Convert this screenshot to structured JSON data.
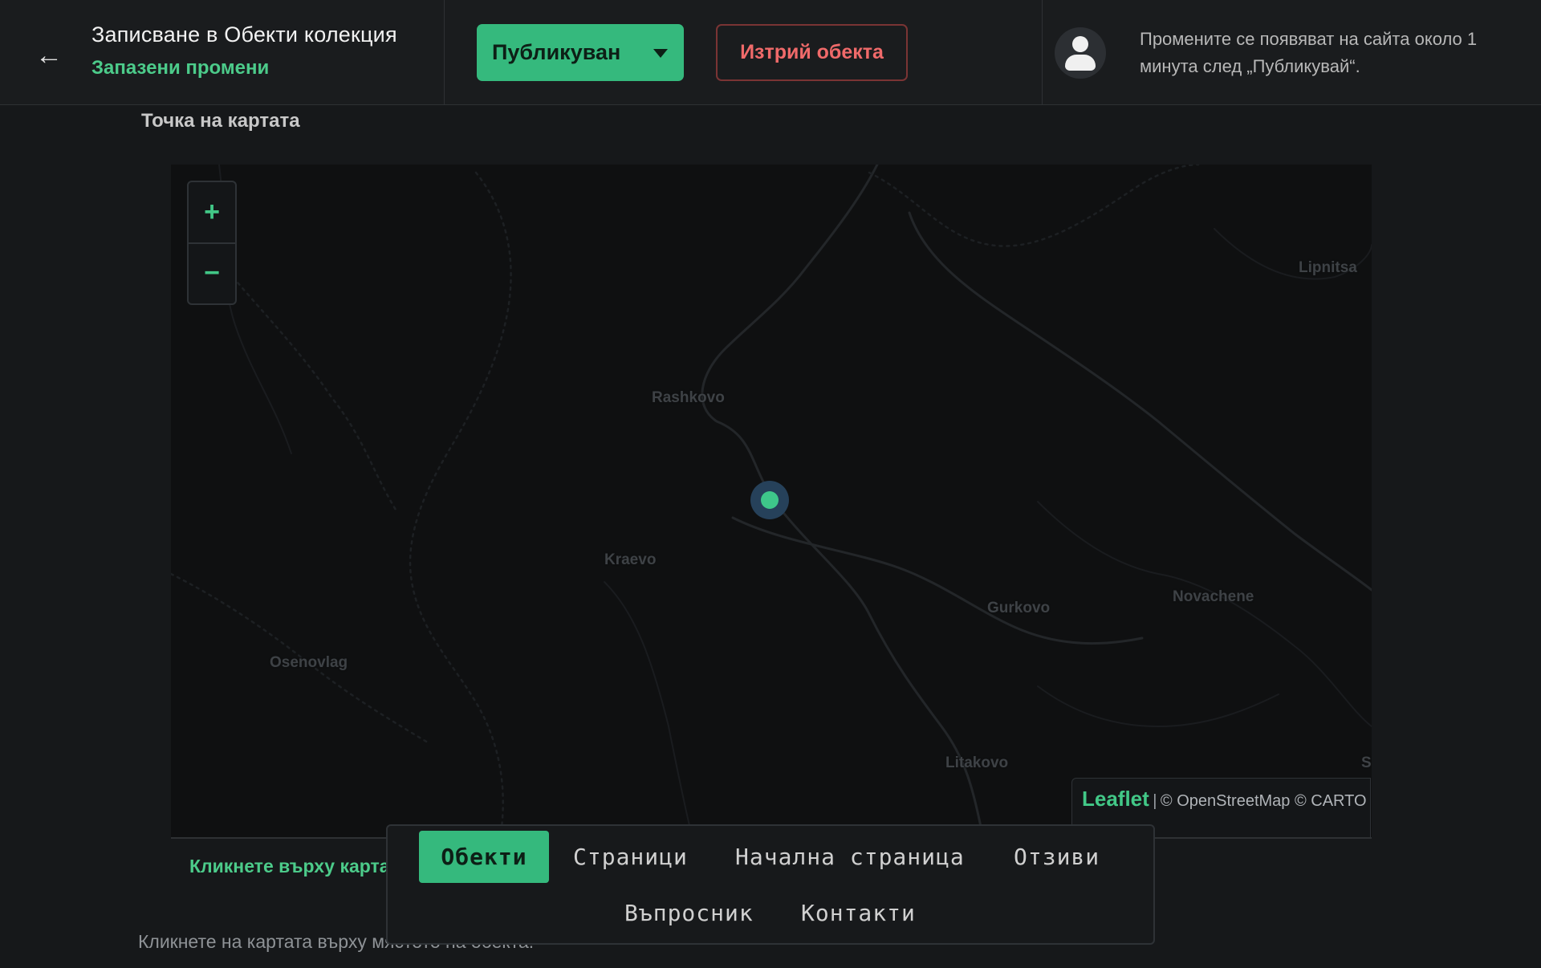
{
  "header": {
    "title": "Записване в Обекти колекция",
    "save_status": "Запазени промени",
    "status_select": "Публикуван",
    "delete_label": "Изтрий обекта",
    "notice": "Промените се появяват на сайта около 1 минута след „Публикувай“."
  },
  "map_section": {
    "label": "Точка на картата",
    "hint": "Кликнете върху карта",
    "helper": "Кликнете на картата върху мястото на обекта."
  },
  "map": {
    "zoom_in": "+",
    "zoom_out": "−",
    "places": [
      "Rashkovo",
      "Kraevo",
      "Osenovlag",
      "Gurkovo",
      "Novachene",
      "Litakovo",
      "Lipnitsa",
      "S"
    ],
    "attribution": {
      "leaflet": "Leaflet",
      "separator": "|",
      "text": "© OpenStreetMap © CARTO"
    }
  },
  "nav": {
    "items": [
      "Обекти",
      "Страници",
      "Начална страница",
      "Отзиви",
      "Въпросник",
      "Контакти"
    ],
    "active": "Обекти"
  },
  "colors": {
    "accent": "#35b97d",
    "danger": "#f06a6a",
    "background": "#16181a",
    "map_background": "#0f1011"
  },
  "icons": {
    "back": "arrow-left-icon",
    "avatar": "user-icon",
    "dropdown": "caret-down-icon",
    "marker": "map-pin-icon"
  }
}
